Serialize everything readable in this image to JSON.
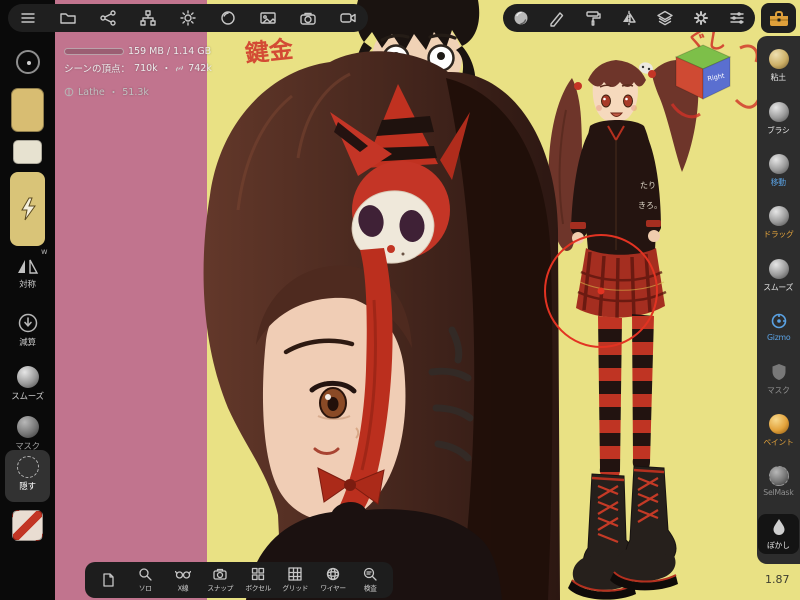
{
  "viewport": {
    "zoom": "1.87",
    "bg_left": "#c1748e",
    "bg_main": "#e9e184",
    "brush_color": "#e23322"
  },
  "colors": {
    "accent_blue": "#5aa2e4",
    "accent_orange": "#e2a23b",
    "toolbar_bg": "#1f1f1f",
    "right_strip_bg": "#2d2d2d",
    "toolbox_orange": "#dfa03b"
  },
  "status_panel": {
    "memory": "159 MB / 1.14 GB",
    "scene_label": "シーンの頂点：",
    "scene_total": "710k",
    "scene_selected": "742k",
    "dot": "・",
    "object_name": "Lathe",
    "object_count": "51.3k"
  },
  "top_left_toolbar": {
    "icons": [
      "menu",
      "folder",
      "node-graph",
      "scene-hierarchy",
      "light",
      "material-sphere",
      "image",
      "camera",
      "video-camera"
    ]
  },
  "top_right_toolbar": {
    "icons": [
      "matcap-sphere",
      "pen",
      "paint-roller",
      "symmetry",
      "layers",
      "settings-gear",
      "sliders"
    ]
  },
  "toolbox": {
    "icon": "toolbox"
  },
  "left_toolbar": {
    "hint": "w",
    "items": [
      {
        "id": "stroke",
        "label": ""
      },
      {
        "id": "color-swatch",
        "label": ""
      },
      {
        "id": "material-swatch",
        "label": ""
      },
      {
        "id": "intensity",
        "label": ""
      },
      {
        "id": "symmetry",
        "label": "対称"
      },
      {
        "id": "subtract",
        "label": "減算"
      },
      {
        "id": "smooth",
        "label": "スムーズ"
      },
      {
        "id": "mask",
        "label": "マスク"
      },
      {
        "id": "hide",
        "label": "隠す",
        "selected": true
      },
      {
        "id": "background-swatch",
        "label": ""
      }
    ]
  },
  "right_toolbar": {
    "items": [
      {
        "label": "粘土",
        "accent": "default"
      },
      {
        "label": "ブラシ",
        "accent": "default"
      },
      {
        "label": "移動",
        "accent": "blue"
      },
      {
        "label": "ドラッグ",
        "accent": "orange"
      },
      {
        "label": "スムーズ",
        "accent": "default"
      },
      {
        "label": "Gizmo",
        "accent": "blue"
      },
      {
        "label": "マスク",
        "accent": "muted"
      },
      {
        "label": "ペイント",
        "accent": "orange"
      },
      {
        "label": "SelMask",
        "accent": "muted"
      },
      {
        "label": "ぼかし",
        "accent": "default",
        "selected": true
      }
    ]
  },
  "bottom_toolbar": {
    "items": [
      {
        "label": "",
        "icon": "document"
      },
      {
        "label": "ソロ",
        "icon": "magnifier"
      },
      {
        "label": "X線",
        "icon": "glasses"
      },
      {
        "label": "スナップ",
        "icon": "snap-camera"
      },
      {
        "label": "ボクセル",
        "icon": "voxel-grid"
      },
      {
        "label": "グリッド",
        "icon": "grid"
      },
      {
        "label": "ワイヤー",
        "icon": "wireframe-sphere"
      },
      {
        "label": "検査",
        "icon": "inspect-magnifier"
      }
    ]
  },
  "view_cube": {
    "right_face": "Right"
  },
  "annotations": {
    "scribble_1": "鍵金",
    "scribble_2": "昌弘",
    "scribble_3": "きき",
    "scribble_4": "ぐし",
    "jacket_text_1": "たり",
    "jacket_text_2": "きろ。"
  }
}
